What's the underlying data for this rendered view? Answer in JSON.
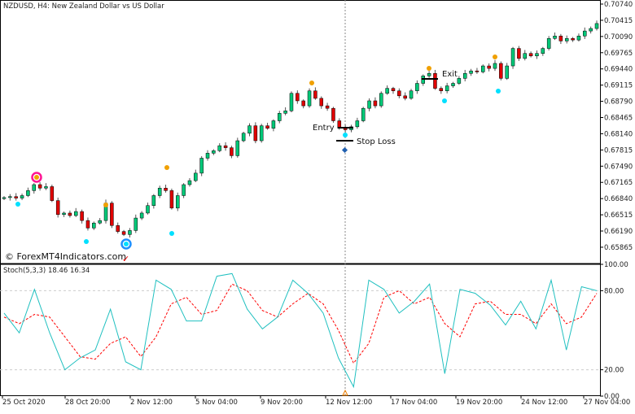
{
  "header": {
    "title": "NZDUSD, H4:  New Zealand Dollar vs US Dollar"
  },
  "watermark": "© ForexMT4Indicators.com",
  "annotations": {
    "entry": "Entry",
    "exit": "Exit",
    "stop_loss": "Stop Loss",
    "checkmark": "✓"
  },
  "colors": {
    "bull": "#00c878",
    "bear": "#e00000",
    "stoch_main": "#20c0c0",
    "stoch_signal": "#ff0000",
    "buy_marker": "#00e0ff",
    "sell_marker": "#f0a000",
    "circle_pink": "#ff1493",
    "circle_blue": "#1e90ff"
  },
  "chart_data": [
    {
      "type": "candlestick",
      "title": "NZDUSD, H4:  New Zealand Dollar vs US Dollar",
      "ylim": [
        0.6575,
        0.7085
      ],
      "y_ticks": [
        "0.70740",
        "0.70415",
        "0.70090",
        "0.69765",
        "0.69440",
        "0.69115",
        "0.68790",
        "0.68465",
        "0.68140",
        "0.67815",
        "0.67490",
        "0.67165",
        "0.66840",
        "0.66515",
        "0.66190",
        "0.65865"
      ],
      "closes": [
        0.6686,
        0.6688,
        0.6685,
        0.669,
        0.67,
        0.6712,
        0.6705,
        0.6708,
        0.668,
        0.6652,
        0.6655,
        0.665,
        0.6658,
        0.664,
        0.6625,
        0.6635,
        0.664,
        0.6675,
        0.663,
        0.6618,
        0.6612,
        0.662,
        0.6645,
        0.6655,
        0.667,
        0.669,
        0.6705,
        0.67,
        0.6665,
        0.669,
        0.6712,
        0.672,
        0.6735,
        0.6765,
        0.6775,
        0.678,
        0.679,
        0.6786,
        0.677,
        0.68,
        0.6815,
        0.683,
        0.68,
        0.683,
        0.6825,
        0.684,
        0.6855,
        0.686,
        0.6895,
        0.688,
        0.687,
        0.69,
        0.6885,
        0.687,
        0.6865,
        0.684,
        0.6825,
        0.6822,
        0.6828,
        0.684,
        0.6865,
        0.688,
        0.687,
        0.6895,
        0.6905,
        0.69,
        0.689,
        0.6885,
        0.69,
        0.6915,
        0.693,
        0.6935,
        0.6905,
        0.69,
        0.691,
        0.6915,
        0.6925,
        0.6935,
        0.694,
        0.6938,
        0.695,
        0.6945,
        0.6955,
        0.6925,
        0.695,
        0.6985,
        0.6965,
        0.6975,
        0.697,
        0.6975,
        0.6985,
        0.7005,
        0.701,
        0.7,
        0.7005,
        0.7002,
        0.701,
        0.702,
        0.7025,
        0.7035
      ],
      "x_ticks": [
        "25 Oct 2020",
        "28 Oct 20:00",
        "2 Nov 12:00",
        "5 Nov 04:00",
        "9 Nov 20:00",
        "12 Nov 12:00",
        "17 Nov 04:00",
        "19 Nov 20:00",
        "24 Nov 12:00",
        "27 Nov 04:00"
      ]
    },
    {
      "type": "line",
      "title": "Stoch(5,3,3) 18.46 16.34",
      "ylim": [
        0,
        100
      ],
      "y_ticks": [
        "100.00",
        "80.00",
        "20.00",
        "0.00"
      ],
      "levels": [
        80,
        20
      ],
      "series": [
        {
          "values": [
            63,
            48,
            81,
            48,
            20,
            29,
            35,
            66,
            26,
            20,
            88,
            81,
            57,
            57,
            91,
            93,
            66,
            51,
            60,
            88,
            78,
            63,
            29,
            7,
            88,
            81,
            63,
            72,
            85,
            17,
            81,
            78,
            69,
            54,
            72,
            51,
            88,
            35,
            83,
            80
          ]
        },
        {
          "values": [
            60,
            55,
            62,
            60,
            45,
            30,
            28,
            40,
            45,
            30,
            45,
            70,
            75,
            62,
            65,
            85,
            80,
            65,
            60,
            70,
            78,
            70,
            50,
            25,
            40,
            75,
            80,
            70,
            75,
            55,
            45,
            70,
            72,
            62,
            62,
            55,
            70,
            55,
            60,
            78
          ]
        }
      ]
    }
  ]
}
